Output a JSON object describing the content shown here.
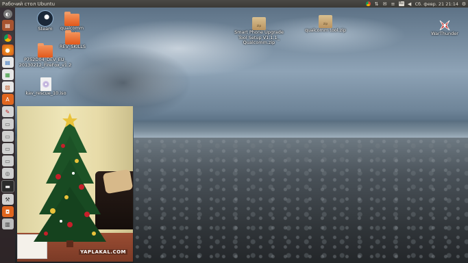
{
  "top_panel": {
    "title": "Рабочий стол Ubuntu",
    "tray": {
      "clock": "Сб. февр. 21 21:14",
      "icons": [
        "chrome-icon",
        "network-icon",
        "mail-icon",
        "audio-icon",
        "keyboard-icon",
        "volume-icon",
        "settings-icon"
      ],
      "keyboard_label": "Ru"
    }
  },
  "launcher": {
    "items": [
      {
        "name": "dash-home",
        "glyph": "◐"
      },
      {
        "name": "files",
        "glyph": "▤"
      },
      {
        "name": "chrome",
        "glyph": "◉"
      },
      {
        "name": "firefox",
        "glyph": "●"
      },
      {
        "name": "writer",
        "glyph": "▤"
      },
      {
        "name": "calc",
        "glyph": "▦"
      },
      {
        "name": "impress",
        "glyph": "▧"
      },
      {
        "name": "software-center",
        "glyph": "A"
      },
      {
        "name": "settings",
        "glyph": "✎"
      },
      {
        "name": "drive-1",
        "glyph": "▭"
      },
      {
        "name": "drive-2",
        "glyph": "▭"
      },
      {
        "name": "drive-3",
        "glyph": "▭"
      },
      {
        "name": "drive-4",
        "glyph": "▭"
      },
      {
        "name": "disc",
        "glyph": "◎"
      },
      {
        "name": "terminal",
        "glyph": "▬"
      },
      {
        "name": "tool",
        "glyph": "⚒"
      },
      {
        "name": "app-orange",
        "glyph": "◘"
      },
      {
        "name": "trash",
        "glyph": "🗑"
      }
    ]
  },
  "desktop_icons": {
    "steam": "Steam",
    "qualcomm_tool_folder": "qualcomm tool",
    "rev_skills": "REV_SKILLS",
    "p752d04": "P752D04_DEV_EU_\n20130212_FireFox_v1.2",
    "kav_rescue": "kav_rescue_10.iso",
    "smartphone_zip": "Smart Phone Upgrade\nTool Setup V1.1.1_\nQualcomm.zip",
    "qualcomm_zip": "qualcomm tool.zip",
    "warthunder": "WarThunder"
  },
  "photo_overlay": {
    "watermark": "YAPLAKAL.COM"
  }
}
